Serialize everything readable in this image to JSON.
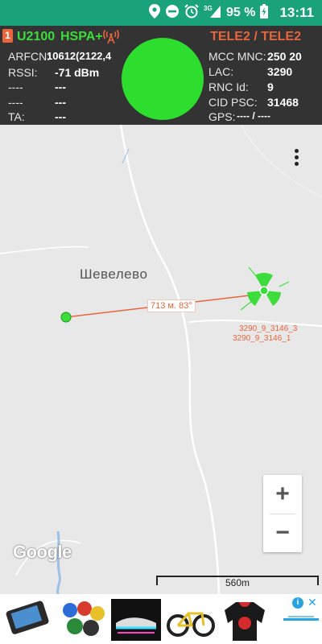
{
  "status_bar": {
    "battery": "95 %",
    "time": "13:11",
    "network": "3G",
    "icons": [
      "location-icon",
      "do-not-disturb-icon",
      "alarm-icon",
      "signal-icon",
      "battery-charging-icon"
    ]
  },
  "cell_info": {
    "sim_slot": "1",
    "band": "U2100",
    "technology": "HSPA+",
    "operator": "TELE2 / TELE2",
    "left_rows": [
      {
        "label": "ARFCN:",
        "value": "10612(2122,4"
      },
      {
        "label": "RSSI:",
        "value": "-71 dBm"
      },
      {
        "label": "----",
        "value": "---"
      },
      {
        "label": "----",
        "value": "---"
      },
      {
        "label": "TA:",
        "value": "---"
      }
    ],
    "right_rows": [
      {
        "label": "MCC MNC:",
        "value": "250 20"
      },
      {
        "label": "LAC:",
        "value": "3290"
      },
      {
        "label": "RNC Id:",
        "value": "9"
      },
      {
        "label": "CID PSC:",
        "value": "31468"
      },
      {
        "label": "GPS:",
        "value": "---- / ----"
      }
    ],
    "signal_color": "#2ede2e",
    "accent_color": "#e8653d"
  },
  "map": {
    "place_name": "Шевелево",
    "distance_label": "713 м. 83°",
    "cell_labels": [
      "3290_9_3146_3",
      "3290_9_3146_1"
    ],
    "scale_label": "560m",
    "zoom_in": "+",
    "zoom_out": "−",
    "attribution": "Google"
  },
  "ad": {
    "info_icon": "i",
    "close_icon": "✕",
    "items": [
      "phone-case-product",
      "bowling-balls-product",
      "light-up-sneakers-product",
      "bicycle-product",
      "hoodie-product"
    ]
  }
}
